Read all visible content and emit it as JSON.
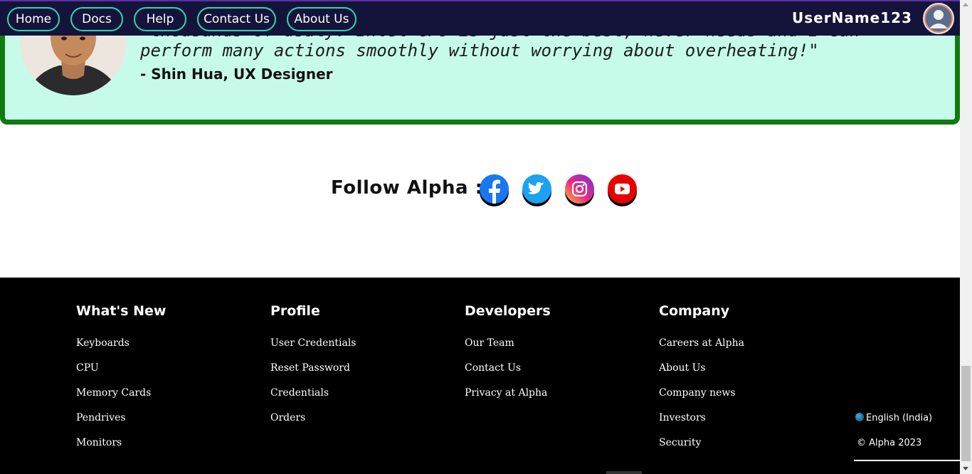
{
  "nav": {
    "items": [
      "Home",
      "Docs",
      "Help",
      "Contact Us",
      "About Us"
    ],
    "username": "UserName123",
    "avatar_icon": "user-avatar-icon"
  },
  "testimonial": {
    "quote_partial": "\"thousands of usaly. Intel CPU is just the best, never needs and I can",
    "quote_line": "perform many actions smoothly without worrying about overheating!\"",
    "author": "- Shin Hua, UX Designer"
  },
  "follow": {
    "label": "Follow Alpha :",
    "icons": [
      "facebook-icon",
      "twitter-icon",
      "instagram-icon",
      "youtube-icon"
    ]
  },
  "footer": {
    "columns": [
      {
        "heading": "What's New",
        "links": [
          "Keyboards",
          "CPU",
          "Memory Cards",
          "Pendrives",
          "Monitors"
        ]
      },
      {
        "heading": "Profile",
        "links": [
          "User Credentials",
          "Reset Password",
          "Credentials",
          "Orders"
        ]
      },
      {
        "heading": "Developers",
        "links": [
          "Our Team",
          "Contact Us",
          "Privacy at Alpha"
        ]
      },
      {
        "heading": "Company",
        "links": [
          "Careers at Alpha",
          "About Us",
          "Company news",
          "Investors",
          "Security"
        ]
      }
    ],
    "language": "English (India)",
    "copyright": "© Alpha 2023"
  },
  "colors": {
    "nav_bg": "#14143a",
    "nav_pill_border": "#2fd6b3",
    "testimonial_bg": "#c6fbea",
    "testimonial_border": "#0f7b0f",
    "footer_bg": "#000000",
    "facebook": "#1877f2",
    "twitter": "#1da1f2",
    "youtube": "#e60000"
  }
}
